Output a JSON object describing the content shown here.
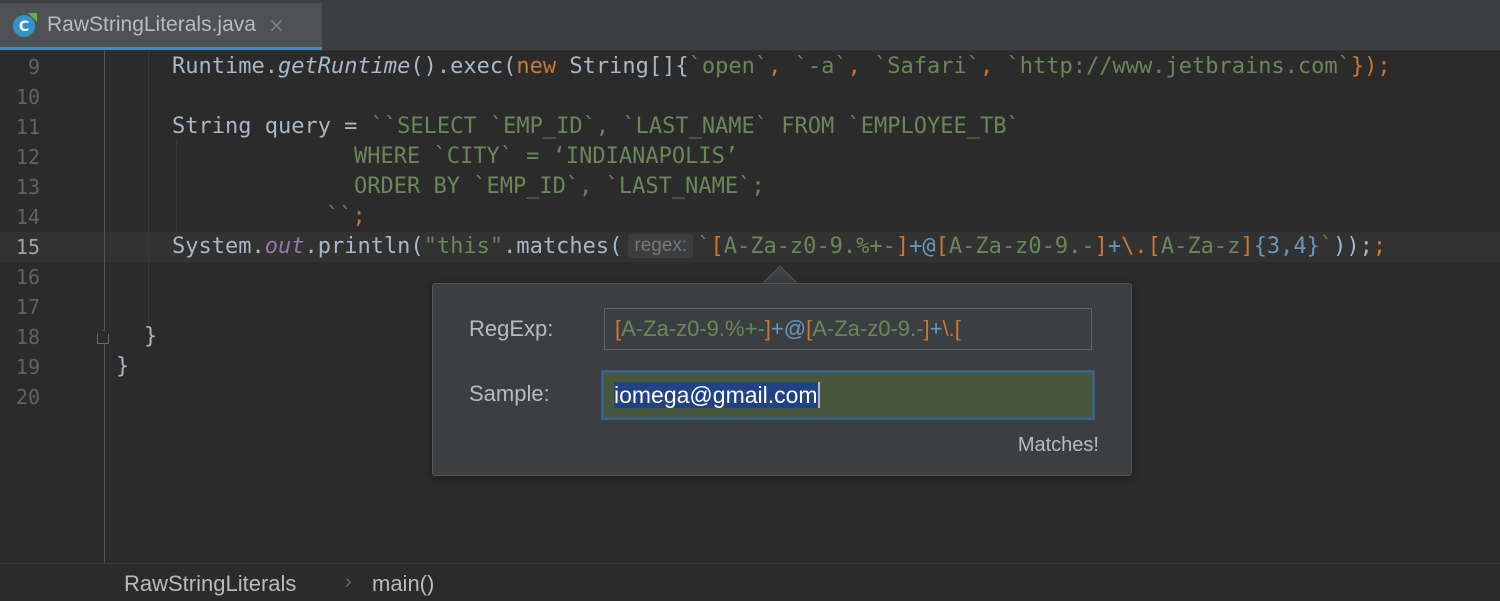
{
  "tab": {
    "label": "RawStringLiterals.java",
    "close": "×"
  },
  "gutter": {
    "lines": [
      "9",
      "10",
      "11",
      "12",
      "13",
      "14",
      "15",
      "16",
      "17",
      "18",
      "19",
      "20"
    ],
    "current": "15"
  },
  "code": {
    "l9": [
      "Runtime.",
      "getRuntime",
      "().exec(",
      "new",
      " String[]{",
      "`open`",
      ", ",
      "`-a`",
      ", ",
      "`Safari`",
      ", ",
      "`http://www.jetbrains.com`",
      "});"
    ],
    "l11": [
      "String query = ",
      "``SELECT `EMP_ID`, `LAST_NAME` FROM `EMPLOYEE_TB`"
    ],
    "l12": "WHERE `CITY` = ‘INDIANAPOLIS’",
    "l13": "ORDER BY `EMP_ID`, `LAST_NAME`;",
    "l14": [
      "``",
      ";"
    ],
    "l15": {
      "prefix": "System.",
      "field": "out",
      "call": ".println(",
      "literal": "\"this\"",
      "method": ".matches(",
      "hint": "regex:",
      "tokens": [
        "`",
        "[",
        "A-Za-z0-9.%+-",
        "]",
        "+@",
        "[",
        "A-Za-z0-9.-",
        "]",
        "+",
        "\\.",
        "[",
        "A-Za-z",
        "]",
        "{",
        "3",
        ",",
        "4",
        "}",
        "`",
        "));"
      ]
    },
    "l18": "}",
    "l19": "}"
  },
  "popup": {
    "regexp_label": "RegExp:",
    "regexp_tokens": [
      "[",
      "A-Za-z0-9.%+-",
      "]",
      "+@",
      "[",
      "A-Za-z0-9.-",
      "]",
      "+",
      "\\.",
      "["
    ],
    "sample_label": "Sample:",
    "sample_value": "iomega@gmail.com",
    "status": "Matches!"
  },
  "breadcrumb": {
    "items": [
      "RawStringLiterals",
      "main()"
    ],
    "separator": "›"
  },
  "colors": {
    "background": "#2b2b2b",
    "keyword": "#cc7832",
    "string": "#6a8759",
    "number": "#6897bb",
    "field": "#9876aa",
    "tab_accent": "#4a88c7",
    "sample_match_bg": "#47573d"
  }
}
